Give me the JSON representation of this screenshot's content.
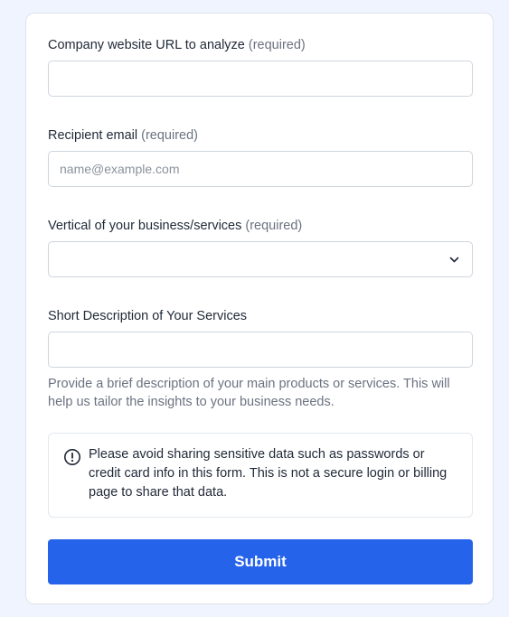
{
  "form": {
    "website": {
      "label": "Company website URL to analyze",
      "required": "(required)",
      "value": "",
      "placeholder": ""
    },
    "email": {
      "label": "Recipient email",
      "required": "(required)",
      "value": "",
      "placeholder": "name@example.com"
    },
    "vertical": {
      "label": "Vertical of your business/services",
      "required": "(required)",
      "selected": "",
      "icon": "chevron-down-icon"
    },
    "description": {
      "label": "Short Description of Your Services",
      "value": "",
      "placeholder": "",
      "help": "Provide a brief description of your main products or services. This will help us tailor the insights to your business needs."
    },
    "notice": {
      "icon": "info-circle-icon",
      "text": "Please avoid sharing sensitive data such as passwords or credit card info in this form. This is not a secure login or billing page to share that data."
    },
    "submit_label": "Submit"
  },
  "colors": {
    "accent": "#2563eb",
    "background": "#f0f4ff",
    "muted_text": "#6b7280"
  }
}
